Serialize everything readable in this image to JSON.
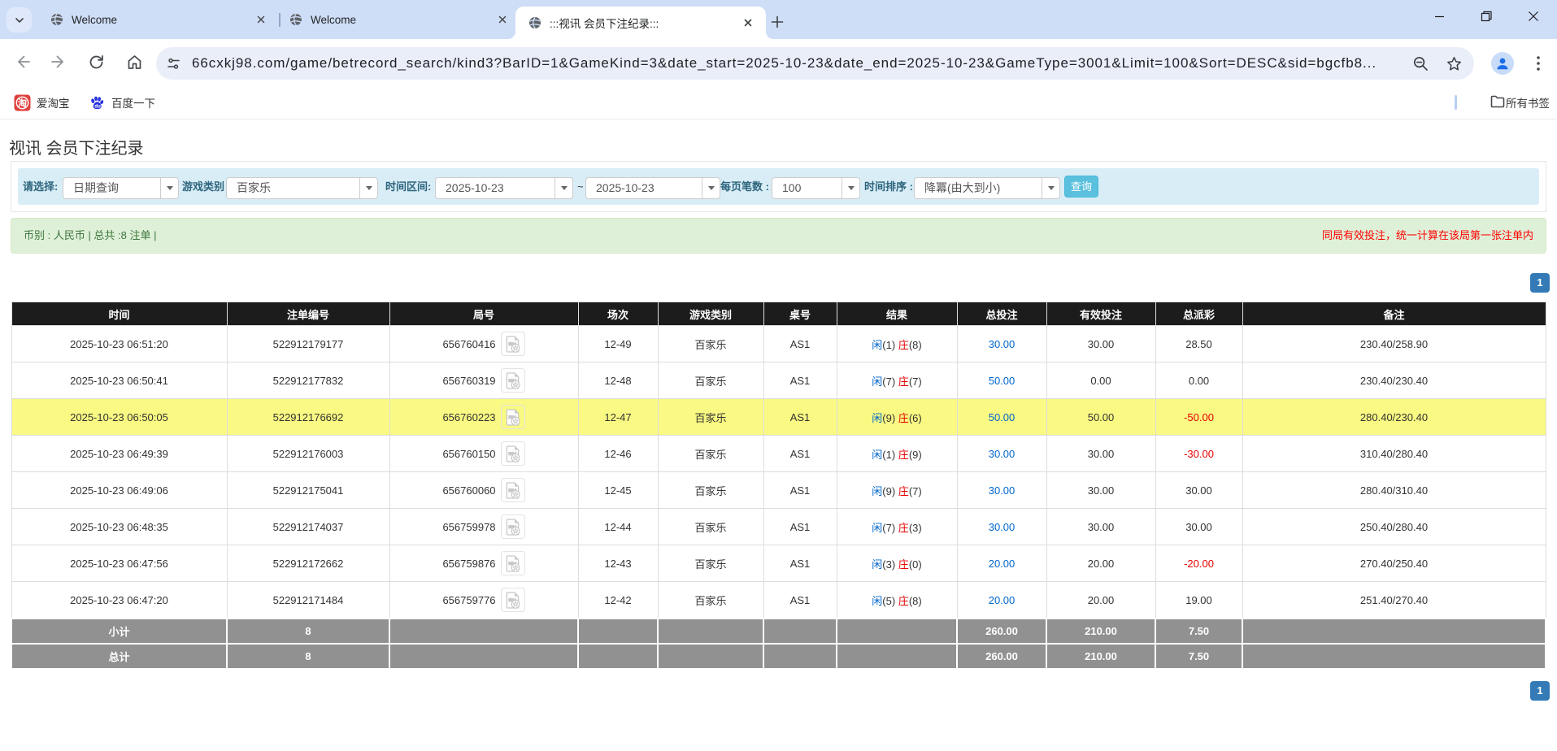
{
  "browser": {
    "tabs": [
      {
        "title": "Welcome"
      },
      {
        "title": "Welcome"
      },
      {
        "title": ":::视讯 会员下注纪录:::"
      }
    ],
    "url": "66cxkj98.com/game/betrecord_search/kind3?BarID=1&GameKind=3&date_start=2025-10-23&date_end=2025-10-23&GameType=3001&Limit=100&Sort=DESC&sid=bgcfb8...",
    "bookmarks": [
      {
        "label": "爱淘宝"
      },
      {
        "label": "百度一下"
      }
    ],
    "all_bookmarks_label": "所有书签",
    "icons": [
      "chevron-down-icon",
      "globe-icon",
      "tab-close-icon",
      "plus-icon",
      "window-minimize-icon",
      "window-restore-icon",
      "window-close-icon",
      "back-icon",
      "forward-icon",
      "reload-icon",
      "home-icon",
      "site-settings-icon",
      "zoom-out-icon",
      "bookmark-star-icon",
      "person-icon",
      "kebab-icon",
      "taobao-icon",
      "baidu-icon",
      "folder-icon"
    ]
  },
  "page": {
    "title": "视讯 会员下注纪录",
    "filters": {
      "select_label": "请选择:",
      "select_value": "日期查询",
      "game_label": "游戏类别",
      "game_value": "百家乐",
      "range_label": "时间区间:",
      "date_start": "2025-10-23",
      "range_sep": "~",
      "date_end": "2025-10-23",
      "page_size_label": "每页笔数 :",
      "page_size_value": "100",
      "sort_label": "时间排序 :",
      "sort_value": "降冪(由大到小)",
      "search_button": "查询"
    },
    "summary": {
      "left": "币别 : 人民币 | 总共 :8 注单 |",
      "right": "同局有效投注，统一计算在该局第一张注单内"
    },
    "pagination": "1",
    "table": {
      "headers": [
        "时间",
        "注单编号",
        "局号",
        "场次",
        "游戏类别",
        "桌号",
        "结果",
        "总投注",
        "有效投注",
        "总派彩",
        "备注"
      ],
      "rows": [
        {
          "time": "2025-10-23 06:51:20",
          "bet_id": "522912179177",
          "round": "656760416",
          "session": "12-49",
          "game": "百家乐",
          "table_no": "AS1",
          "xian": "闲",
          "xian_n": "(1)",
          "zhuang": "庄",
          "zhuang_n": "(8)",
          "total_bet": "30.00",
          "valid_bet": "30.00",
          "payout": "28.50",
          "payout_neg": false,
          "note": "230.40/258.90",
          "highlight": false
        },
        {
          "time": "2025-10-23 06:50:41",
          "bet_id": "522912177832",
          "round": "656760319",
          "session": "12-48",
          "game": "百家乐",
          "table_no": "AS1",
          "xian": "闲",
          "xian_n": "(7)",
          "zhuang": "庄",
          "zhuang_n": "(7)",
          "total_bet": "50.00",
          "valid_bet": "0.00",
          "payout": "0.00",
          "payout_neg": false,
          "note": "230.40/230.40",
          "highlight": false
        },
        {
          "time": "2025-10-23 06:50:05",
          "bet_id": "522912176692",
          "round": "656760223",
          "session": "12-47",
          "game": "百家乐",
          "table_no": "AS1",
          "xian": "闲",
          "xian_n": "(9)",
          "zhuang": "庄",
          "zhuang_n": "(6)",
          "total_bet": "50.00",
          "valid_bet": "50.00",
          "payout": "-50.00",
          "payout_neg": true,
          "note": "280.40/230.40",
          "highlight": true
        },
        {
          "time": "2025-10-23 06:49:39",
          "bet_id": "522912176003",
          "round": "656760150",
          "session": "12-46",
          "game": "百家乐",
          "table_no": "AS1",
          "xian": "闲",
          "xian_n": "(1)",
          "zhuang": "庄",
          "zhuang_n": "(9)",
          "total_bet": "30.00",
          "valid_bet": "30.00",
          "payout": "-30.00",
          "payout_neg": true,
          "note": "310.40/280.40",
          "highlight": false
        },
        {
          "time": "2025-10-23 06:49:06",
          "bet_id": "522912175041",
          "round": "656760060",
          "session": "12-45",
          "game": "百家乐",
          "table_no": "AS1",
          "xian": "闲",
          "xian_n": "(9)",
          "zhuang": "庄",
          "zhuang_n": "(7)",
          "total_bet": "30.00",
          "valid_bet": "30.00",
          "payout": "30.00",
          "payout_neg": false,
          "note": "280.40/310.40",
          "highlight": false
        },
        {
          "time": "2025-10-23 06:48:35",
          "bet_id": "522912174037",
          "round": "656759978",
          "session": "12-44",
          "game": "百家乐",
          "table_no": "AS1",
          "xian": "闲",
          "xian_n": "(7)",
          "zhuang": "庄",
          "zhuang_n": "(3)",
          "total_bet": "30.00",
          "valid_bet": "30.00",
          "payout": "30.00",
          "payout_neg": false,
          "note": "250.40/280.40",
          "highlight": false
        },
        {
          "time": "2025-10-23 06:47:56",
          "bet_id": "522912172662",
          "round": "656759876",
          "session": "12-43",
          "game": "百家乐",
          "table_no": "AS1",
          "xian": "闲",
          "xian_n": "(3)",
          "zhuang": "庄",
          "zhuang_n": "(0)",
          "total_bet": "20.00",
          "valid_bet": "20.00",
          "payout": "-20.00",
          "payout_neg": true,
          "note": "270.40/250.40",
          "highlight": false
        },
        {
          "time": "2025-10-23 06:47:20",
          "bet_id": "522912171484",
          "round": "656759776",
          "session": "12-42",
          "game": "百家乐",
          "table_no": "AS1",
          "xian": "闲",
          "xian_n": "(5)",
          "zhuang": "庄",
          "zhuang_n": "(8)",
          "total_bet": "20.00",
          "valid_bet": "20.00",
          "payout": "19.00",
          "payout_neg": false,
          "note": "251.40/270.40",
          "highlight": false
        }
      ],
      "subtotal": {
        "label": "小计",
        "count": "8",
        "total_bet": "260.00",
        "valid_bet": "210.00",
        "payout": "7.50"
      },
      "total": {
        "label": "总计",
        "count": "8",
        "total_bet": "260.00",
        "valid_bet": "210.00",
        "payout": "7.50"
      }
    },
    "colors": {
      "accent_blue": "#337ab7",
      "filter_bg": "#d9edf7",
      "alert_bg": "#dff0d8",
      "highlight_row": "#f9f983",
      "header_bg": "#1c1c1c"
    },
    "icons": [
      "video-file-icon",
      "caret-down-icon"
    ]
  }
}
